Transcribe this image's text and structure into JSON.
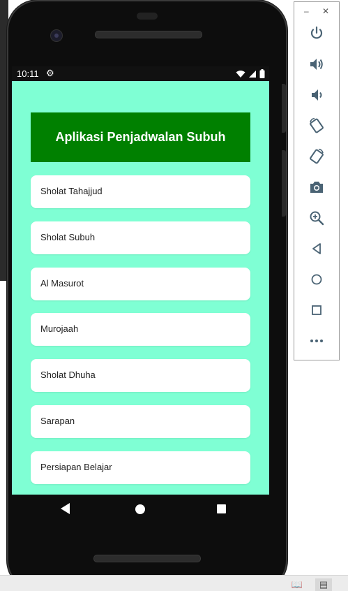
{
  "status_bar": {
    "time": "10:11"
  },
  "app": {
    "title": "Aplikasi Penjadwalan Subuh",
    "background_color": "#7fffd4",
    "title_color": "#008000",
    "items": [
      {
        "label": "Sholat Tahajjud"
      },
      {
        "label": "Sholat Subuh"
      },
      {
        "label": "Al Masurot"
      },
      {
        "label": "Murojaah"
      },
      {
        "label": "Sholat Dhuha"
      },
      {
        "label": "Sarapan"
      },
      {
        "label": "Persiapan Belajar"
      }
    ]
  },
  "navigation": {
    "buttons": [
      "back",
      "home",
      "recents"
    ]
  },
  "emulator_toolbar": {
    "window_controls": [
      "minimize",
      "close"
    ],
    "buttons": [
      "power",
      "volume-up",
      "volume-down",
      "rotate-left",
      "rotate-right",
      "screenshot",
      "zoom",
      "back",
      "home",
      "overview",
      "more"
    ]
  }
}
